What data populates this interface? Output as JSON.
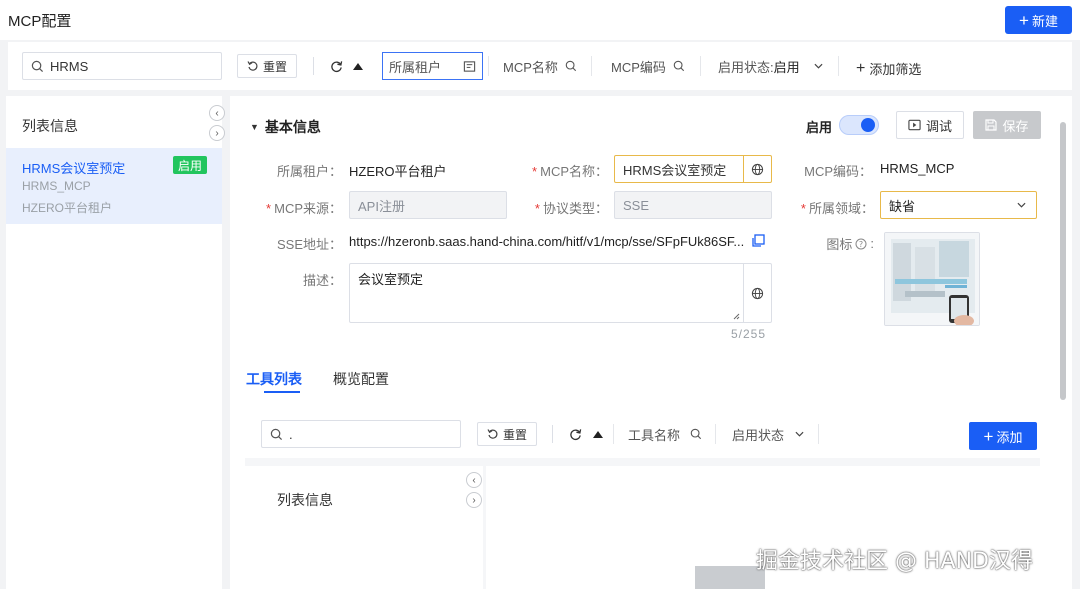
{
  "header": {
    "title": "MCP配置",
    "new_label": "新建"
  },
  "filter": {
    "search_value": "HRMS",
    "reset_label": "重置",
    "tenant_placeholder": "所属租户",
    "mcp_name_placeholder": "MCP名称",
    "mcp_code_placeholder": "MCP编码",
    "status_label": "启用状态:",
    "status_value": "启用",
    "add_filter_label": "添加筛选"
  },
  "sidebar": {
    "title": "列表信息",
    "items": [
      {
        "name": "HRMS会议室预定",
        "code": "HRMS_MCP",
        "tenant": "HZERO平台租户",
        "status": "启用"
      }
    ]
  },
  "basic": {
    "section_title": "基本信息",
    "enable_label": "启用",
    "enabled": true,
    "debug_label": "调试",
    "save_label": "保存",
    "fields": {
      "tenant_label": "所属租户：",
      "tenant_value": "HZERO平台租户",
      "mcp_name_label": "MCP名称：",
      "mcp_name_value": "HRMS会议室预定",
      "mcp_code_label": "MCP编码：",
      "mcp_code_value": "HRMS_MCP",
      "source_label": "MCP来源：",
      "source_value": "API注册",
      "protocol_label": "协议类型：",
      "protocol_value": "SSE",
      "domain_label": "所属领域：",
      "domain_value": "缺省",
      "sse_label": "SSE地址：",
      "sse_value": "https://hzeronb.saas.hand-china.com/hitf/v1/mcp/sse/SFpFUk86SF...",
      "icon_label": "图标",
      "desc_label": "描述：",
      "desc_value": "会议室预定",
      "desc_counter": "5/255"
    }
  },
  "tabs": [
    {
      "label": "工具列表",
      "active": true
    },
    {
      "label": "概览配置",
      "active": false
    }
  ],
  "tools": {
    "search_value": ".",
    "reset_label": "重置",
    "tool_name_placeholder": "工具名称",
    "status_placeholder": "启用状态",
    "add_label": "添加",
    "list_title": "列表信息"
  },
  "watermark": "掘金技术社区 @ HAND汉得",
  "colors": {
    "primary": "#1a5ef5",
    "success": "#22c55e",
    "highlight_border": "#e8b94a",
    "required": "#e53935"
  }
}
